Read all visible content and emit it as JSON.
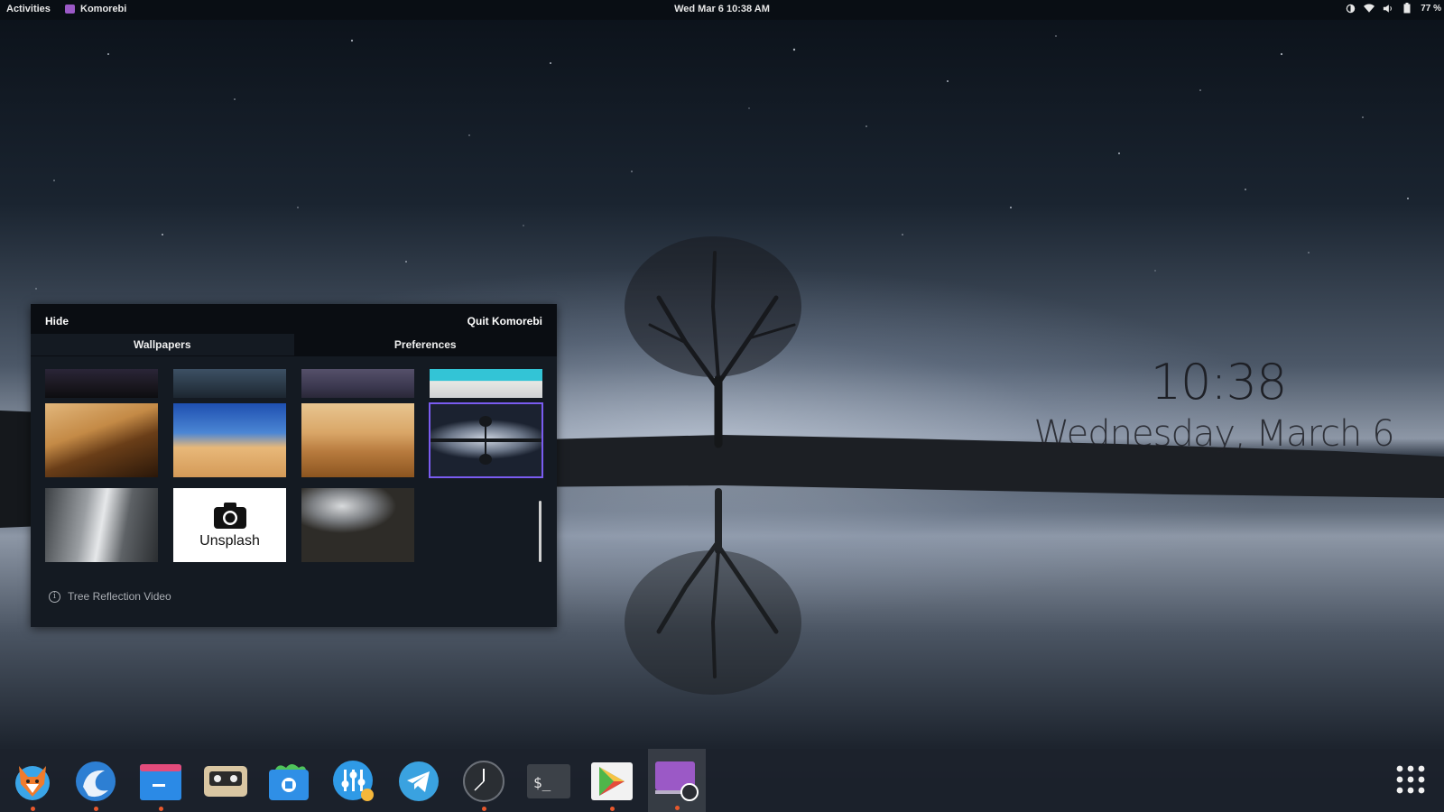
{
  "topbar": {
    "activities": "Activities",
    "app_name": "Komorebi",
    "clock": "Wed Mar 6  10:38 AM",
    "battery_percent": "77 %",
    "tray_icons": [
      "night-light-icon",
      "wifi-icon",
      "volume-icon",
      "battery-icon"
    ]
  },
  "desktop": {
    "time": "10:38",
    "date": "Wednesday, March 6"
  },
  "panel": {
    "hide_label": "Hide",
    "quit_label": "Quit Komorebi",
    "tabs": [
      {
        "label": "Wallpapers",
        "active": true
      },
      {
        "label": "Preferences",
        "active": false
      }
    ],
    "unsplash_label": "Unsplash",
    "current_wallpaper": "Tree Reflection Video",
    "thumbnails": [
      {
        "name": "night-mountains"
      },
      {
        "name": "blue-mountains"
      },
      {
        "name": "purple-sky"
      },
      {
        "name": "pool-side"
      },
      {
        "name": "golden-dunes"
      },
      {
        "name": "blue-sky-desert"
      },
      {
        "name": "amber-desert"
      },
      {
        "name": "tree-reflection",
        "selected": true
      },
      {
        "name": "concrete-corridor"
      },
      {
        "name": "misty-forest"
      }
    ]
  },
  "dock": {
    "apps": [
      {
        "name": "fox-app-icon",
        "running": true
      },
      {
        "name": "browser-icon",
        "running": true
      },
      {
        "name": "files-icon",
        "running": true
      },
      {
        "name": "tape-recorder-icon",
        "running": false
      },
      {
        "name": "software-center-icon",
        "running": false
      },
      {
        "name": "tweaks-icon",
        "running": false
      },
      {
        "name": "telegram-icon",
        "running": false
      },
      {
        "name": "clock-icon",
        "running": true
      },
      {
        "name": "terminal-icon",
        "running": false
      },
      {
        "name": "play-store-icon",
        "running": true
      },
      {
        "name": "komorebi-icon",
        "running": true,
        "active": true
      }
    ],
    "show_apps_icon": "app-grid-icon"
  },
  "colors": {
    "selection": "#7a5cf0",
    "running_dot": "#e8582c",
    "komorebi_accent": "#9b59c6"
  }
}
